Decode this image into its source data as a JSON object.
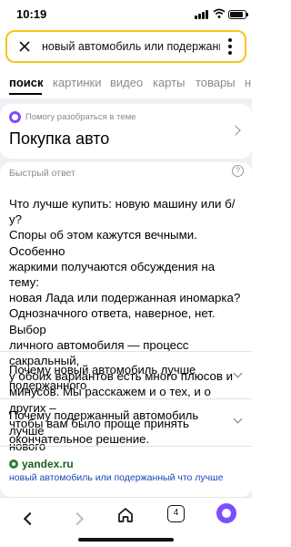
{
  "status_bar": {
    "time": "10:19"
  },
  "search": {
    "query": "новый автомобиль или подержанный",
    "close_icon": "close-icon",
    "more_icon": "more-vertical-icon"
  },
  "tabs": [
    "поиск",
    "картинки",
    "видео",
    "карты",
    "товары",
    "н"
  ],
  "active_tab": "поиск",
  "topic_card": {
    "hint": "Помогу разобраться в теме",
    "title": "Покупка авто"
  },
  "quick_answer": {
    "label": "Быстрый ответ",
    "lines": [
      "Что лучше купить: новую машину или б/у?",
      "Споры об этом кажутся вечными. Особенно",
      "жаркими получаются обсуждения на тему:",
      "новая Лада или подержанная иномарка?",
      "Однозначного ответа, наверное, нет. Выбор",
      "личного автомобиля — процесс сакральный,",
      "у обоих вариантов есть много плюсов и",
      "минусов. Мы расскажем и о тех, и о других –",
      "чтобы вам было проще принять",
      "окончательное решение."
    ],
    "faq": [
      {
        "line1": "Почему новый автомобиль лучше",
        "line2": "подержанного"
      },
      {
        "line1": "Почему подержанный автомобиль лучше",
        "line2": "нового"
      }
    ],
    "source_domain": "yandex.ru",
    "source_link": "новый автомобиль или подержанный что лучше"
  },
  "bottom_nav": {
    "tabs_count": "4"
  },
  "colors": {
    "accent": "#f5c518",
    "alice": "#7c4dff",
    "link": "#1a46b8",
    "source": "#1b5e20"
  }
}
